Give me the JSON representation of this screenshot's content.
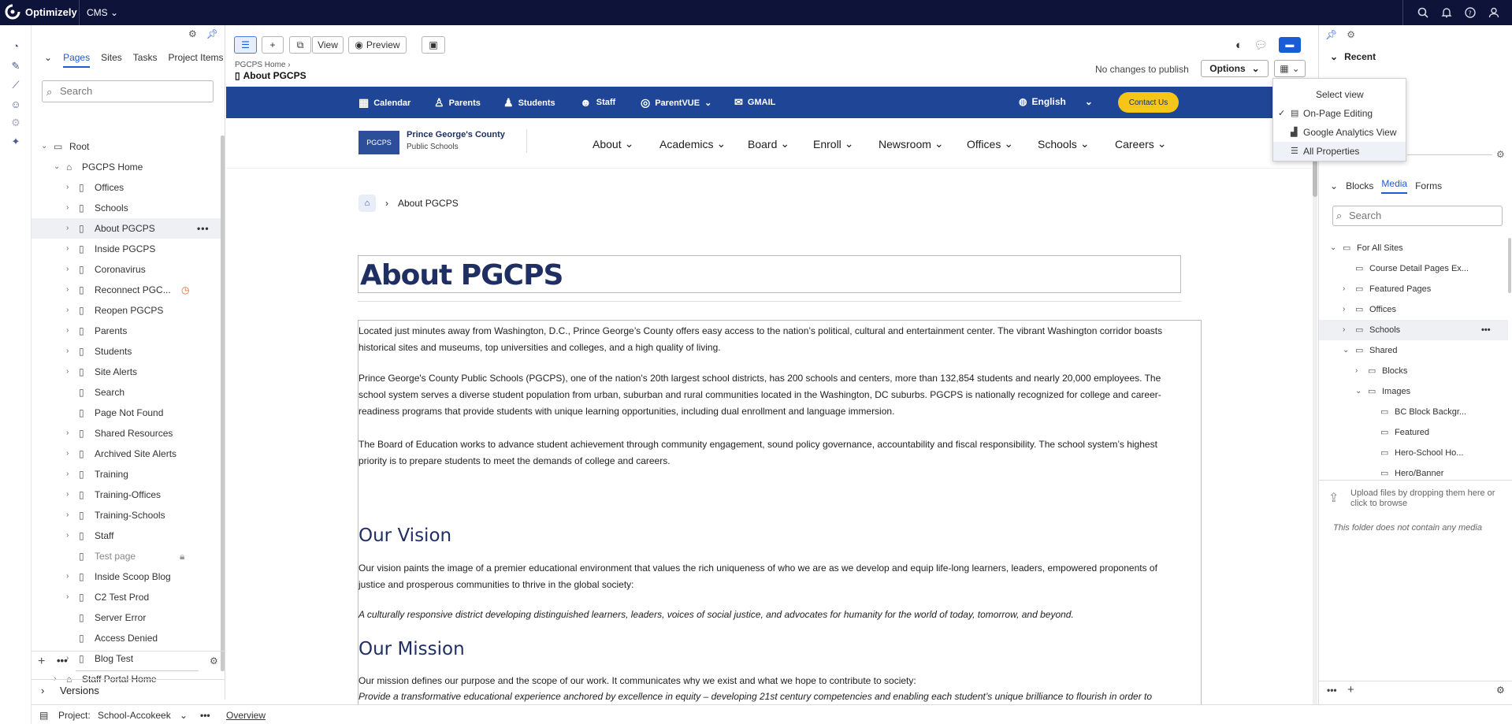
{
  "app": {
    "brand": "Optimizely",
    "product": "CMS"
  },
  "colors": {
    "topbar": "#0d1339",
    "accent": "#1a5cd6",
    "site_nav": "#1f4597",
    "contact_button": "#f5c518",
    "heading": "#1f2f63"
  },
  "topbar_icons": [
    "search-icon",
    "bell-icon",
    "help-icon",
    "user-icon"
  ],
  "rail_icons": [
    "dashboard-icon",
    "edit-icon",
    "reports-icon",
    "users-icon",
    "settings-icon",
    "addons-icon"
  ],
  "page_tree": {
    "tabs": [
      "Pages",
      "Sites",
      "Tasks",
      "Project Items"
    ],
    "active_tab": "Pages",
    "search_placeholder": "Search",
    "items": [
      {
        "label": "Root",
        "depth": 0,
        "expanded": true
      },
      {
        "label": "PGCPS Home",
        "depth": 1,
        "expanded": true
      },
      {
        "label": "Offices",
        "depth": 2
      },
      {
        "label": "Schools",
        "depth": 2
      },
      {
        "label": "About PGCPS",
        "depth": 2,
        "selected": true
      },
      {
        "label": "Inside PGCPS",
        "depth": 2
      },
      {
        "label": "Coronavirus",
        "depth": 2
      },
      {
        "label": "Reconnect PGC...",
        "depth": 2,
        "scheduled": true
      },
      {
        "label": "Reopen PGCPS",
        "depth": 2
      },
      {
        "label": "Parents",
        "depth": 2
      },
      {
        "label": "Students",
        "depth": 2
      },
      {
        "label": "Site Alerts",
        "depth": 2
      },
      {
        "label": "Search",
        "depth": 2,
        "leaf": true
      },
      {
        "label": "Page Not Found",
        "depth": 2,
        "leaf": true
      },
      {
        "label": "Shared Resources",
        "depth": 2
      },
      {
        "label": "Archived Site Alerts",
        "depth": 2
      },
      {
        "label": "Training",
        "depth": 2
      },
      {
        "label": "Training-Offices",
        "depth": 2
      },
      {
        "label": "Training-Schools",
        "depth": 2
      },
      {
        "label": "Staff",
        "depth": 2
      },
      {
        "label": "Test page",
        "depth": 2,
        "leaf": true,
        "locked": true
      },
      {
        "label": "Inside Scoop Blog",
        "depth": 2
      },
      {
        "label": "C2 Test Prod",
        "depth": 2
      },
      {
        "label": "Server Error",
        "depth": 2,
        "leaf": true
      },
      {
        "label": "Access Denied",
        "depth": 2,
        "leaf": true
      },
      {
        "label": "Blog Test",
        "depth": 2
      },
      {
        "label": "Staff Portal Home",
        "depth": 1
      }
    ]
  },
  "versions_label": "Versions",
  "status_bar": {
    "project_label": "Project:",
    "project_name": "School-Accokeek",
    "overview_link": "Overview"
  },
  "toolbar": {
    "view_label": "View",
    "preview_label": "Preview",
    "breadcrumb": "PGCPS Home",
    "page_title": "About PGCPS",
    "publish_status": "No changes to publish",
    "options_label": "Options"
  },
  "view_menu": {
    "title": "Select view",
    "items": [
      {
        "label": "On-Page Editing",
        "checked": true
      },
      {
        "label": "Google Analytics View",
        "checked": false
      },
      {
        "label": "All Properties",
        "checked": false,
        "highlighted": true
      }
    ]
  },
  "site": {
    "nav": [
      "Calendar",
      "Parents",
      "Students",
      "Staff",
      "ParentVUE",
      "GMAIL"
    ],
    "language": "English",
    "contact_label": "Contact Us",
    "logo_text": "PGCPS",
    "org_name": "Prince George's County",
    "org_sub": "Public Schools",
    "main_nav": [
      "About",
      "Academics",
      "Board",
      "Enroll",
      "Newsroom",
      "Offices",
      "Schools",
      "Careers"
    ],
    "crumb": "About PGCPS",
    "heading": "About PGCPS",
    "paragraphs": [
      "Located just minutes away from Washington, D.C., Prince George’s County offers easy access to the nation’s political, cultural and entertainment center. The vibrant Washington corridor boasts historical sites and museums, top universities and colleges, and a high quality of living.",
      "Prince George's County Public Schools (PGCPS), one of the nation's 20th largest school districts, has 200 schools and centers, more than 132,854 students and nearly 20,000 employees. The school system serves a diverse student population from urban, suburban and rural communities located in the Washington, DC suburbs. PGCPS is nationally recognized for college and career-readiness programs that provide students with unique learning opportunities, including dual enrollment and language immersion.",
      "The Board of Education works to advance student achievement through community engagement, sound policy governance, accountability and fiscal responsibility. The school system’s highest priority is to prepare students to meet the demands of college and careers."
    ],
    "vision_heading": "Our Vision",
    "vision_text": "Our vision paints the image of a premier educational environment that values the rich uniqueness of who we are as we develop and equip life-long learners, leaders, empowered proponents of justice and prosperous communities to thrive in the global society:",
    "vision_quote": "A culturally responsive district developing distinguished learners, leaders, voices of social justice, and advocates for humanity for the world of today, tomorrow, and beyond.",
    "mission_heading": "Our Mission",
    "mission_text": "Our mission defines our purpose and the scope of our work. It communicates why we exist and what we hope to contribute to society:",
    "mission_quote": "Provide a transformative educational experience anchored by excellence in equity – developing 21st century competencies and enabling each student’s unique brilliance to flourish in order to"
  },
  "assets": {
    "recent_label": "Recent",
    "tabs": [
      "Blocks",
      "Media",
      "Forms"
    ],
    "active_tab": "Media",
    "search_placeholder": "Search",
    "items": [
      {
        "label": "For All Sites",
        "depth": 0,
        "expanded": true
      },
      {
        "label": "Course Detail Pages Ex...",
        "depth": 1,
        "leaf": true
      },
      {
        "label": "Featured Pages",
        "depth": 1
      },
      {
        "label": "Offices",
        "depth": 1
      },
      {
        "label": "Schools",
        "depth": 1,
        "selected": true
      },
      {
        "label": "Shared",
        "depth": 1,
        "expanded": true
      },
      {
        "label": "Blocks",
        "depth": 2
      },
      {
        "label": "Images",
        "depth": 2,
        "expanded": true
      },
      {
        "label": "BC Block Backgr...",
        "depth": 3,
        "leaf": true
      },
      {
        "label": "Featured",
        "depth": 3,
        "leaf": true
      },
      {
        "label": "Hero-School Ho...",
        "depth": 3,
        "leaf": true
      },
      {
        "label": "Hero/Banner",
        "depth": 3,
        "leaf": true
      }
    ],
    "upload_text": "Upload files by dropping them here or click to browse",
    "empty_text": "This folder does not contain any media"
  }
}
